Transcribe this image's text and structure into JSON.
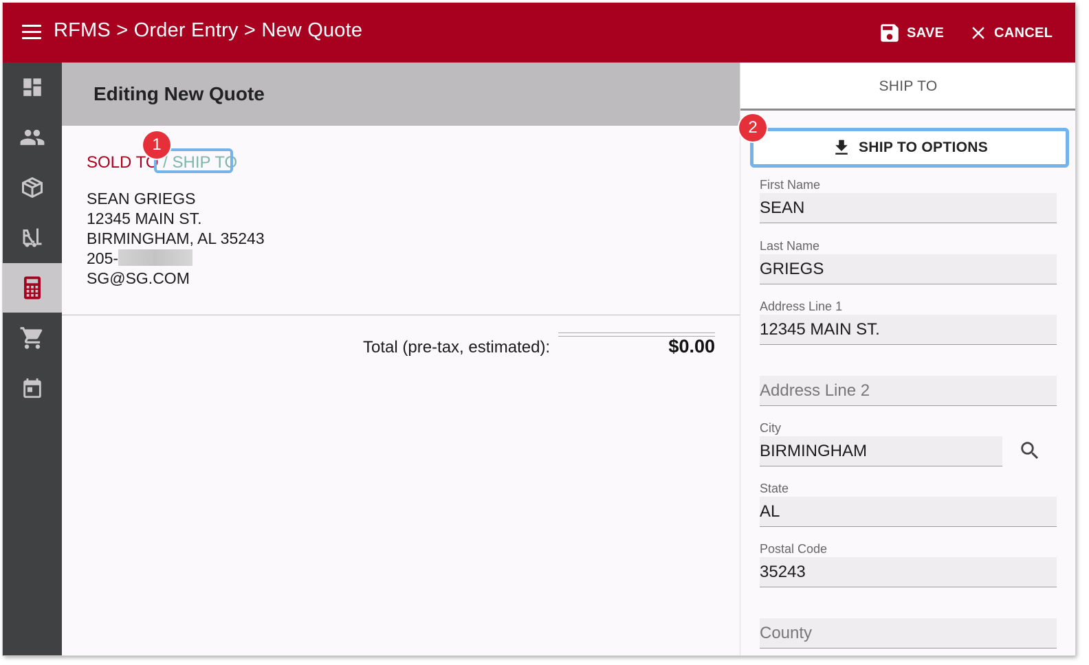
{
  "topbar": {
    "title": "RFMS > Order Entry > New Quote",
    "save_label": "SAVE",
    "cancel_label": "CANCEL",
    "color": "#a8001f"
  },
  "sidebar": {
    "items": [
      {
        "icon": "dashboard-icon"
      },
      {
        "icon": "people-icon"
      },
      {
        "icon": "box-icon"
      },
      {
        "icon": "forklift-icon"
      },
      {
        "icon": "calculator-icon",
        "active": true
      },
      {
        "icon": "cart-icon"
      },
      {
        "icon": "calendar-icon"
      }
    ]
  },
  "main": {
    "title": "Editing New Quote",
    "tabs": {
      "sold_to": "SOLD TO",
      "separator": "/",
      "ship_to": "SHIP TO"
    },
    "address": {
      "name": "SEAN GRIEGS",
      "street": "12345 MAIN ST.",
      "city_state_zip": "BIRMINGHAM, AL 35243",
      "phone_prefix": "205-",
      "email": "SG@SG.COM"
    },
    "total_label": "Total (pre-tax, estimated):",
    "total_value": "$0.00"
  },
  "annotations": {
    "badge1": "1",
    "badge2": "2"
  },
  "right_panel": {
    "tab": "SHIP TO",
    "options_button": "SHIP TO OPTIONS",
    "fields": {
      "first_name": {
        "label": "First Name",
        "value": "SEAN"
      },
      "last_name": {
        "label": "Last Name",
        "value": "GRIEGS"
      },
      "address1": {
        "label": "Address Line 1",
        "value": "12345 MAIN ST."
      },
      "address2": {
        "placeholder": "Address Line 2",
        "value": ""
      },
      "city": {
        "label": "City",
        "value": "BIRMINGHAM"
      },
      "state": {
        "label": "State",
        "value": "AL"
      },
      "postal": {
        "label": "Postal Code",
        "value": "35243"
      },
      "county": {
        "placeholder": "County",
        "value": ""
      }
    }
  }
}
